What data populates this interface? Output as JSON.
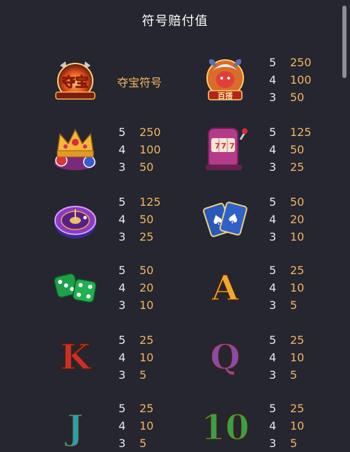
{
  "title": "符号赔付值",
  "bonus": {
    "label": "夺宝符号",
    "icon_text": "夺宝"
  },
  "wild_icon_text": "百搭",
  "symbols": [
    {
      "icon": "wild-devil-icon",
      "pays": [
        {
          "count": "5",
          "value": "250"
        },
        {
          "count": "4",
          "value": "100"
        },
        {
          "count": "3",
          "value": "50"
        }
      ]
    },
    {
      "icon": "crown-chips-icon",
      "pays": [
        {
          "count": "5",
          "value": "250"
        },
        {
          "count": "4",
          "value": "100"
        },
        {
          "count": "3",
          "value": "50"
        }
      ]
    },
    {
      "icon": "slot-machine-icon",
      "pays": [
        {
          "count": "5",
          "value": "125"
        },
        {
          "count": "4",
          "value": "50"
        },
        {
          "count": "3",
          "value": "25"
        }
      ]
    },
    {
      "icon": "roulette-icon",
      "pays": [
        {
          "count": "5",
          "value": "125"
        },
        {
          "count": "4",
          "value": "50"
        },
        {
          "count": "3",
          "value": "25"
        }
      ]
    },
    {
      "icon": "playing-cards-icon",
      "pays": [
        {
          "count": "5",
          "value": "50"
        },
        {
          "count": "4",
          "value": "20"
        },
        {
          "count": "3",
          "value": "10"
        }
      ]
    },
    {
      "icon": "dice-icon",
      "pays": [
        {
          "count": "5",
          "value": "50"
        },
        {
          "count": "4",
          "value": "20"
        },
        {
          "count": "3",
          "value": "10"
        }
      ]
    },
    {
      "icon": "letter-a-icon",
      "letter": "A",
      "pays": [
        {
          "count": "5",
          "value": "25"
        },
        {
          "count": "4",
          "value": "10"
        },
        {
          "count": "3",
          "value": "5"
        }
      ]
    },
    {
      "icon": "letter-k-icon",
      "letter": "K",
      "pays": [
        {
          "count": "5",
          "value": "25"
        },
        {
          "count": "4",
          "value": "10"
        },
        {
          "count": "3",
          "value": "5"
        }
      ]
    },
    {
      "icon": "letter-q-icon",
      "letter": "Q",
      "pays": [
        {
          "count": "5",
          "value": "25"
        },
        {
          "count": "4",
          "value": "10"
        },
        {
          "count": "3",
          "value": "5"
        }
      ]
    },
    {
      "icon": "letter-j-icon",
      "letter": "J",
      "pays": [
        {
          "count": "5",
          "value": "25"
        },
        {
          "count": "4",
          "value": "10"
        },
        {
          "count": "3",
          "value": "5"
        }
      ]
    },
    {
      "icon": "number-10-icon",
      "letter": "10",
      "pays": [
        {
          "count": "5",
          "value": "25"
        },
        {
          "count": "4",
          "value": "10"
        },
        {
          "count": "3",
          "value": "5"
        }
      ]
    }
  ],
  "colors": {
    "background": "#25262f",
    "count_text": "#e8e8ee",
    "value_text": "#f2b463",
    "title_text": "#ffffff"
  }
}
